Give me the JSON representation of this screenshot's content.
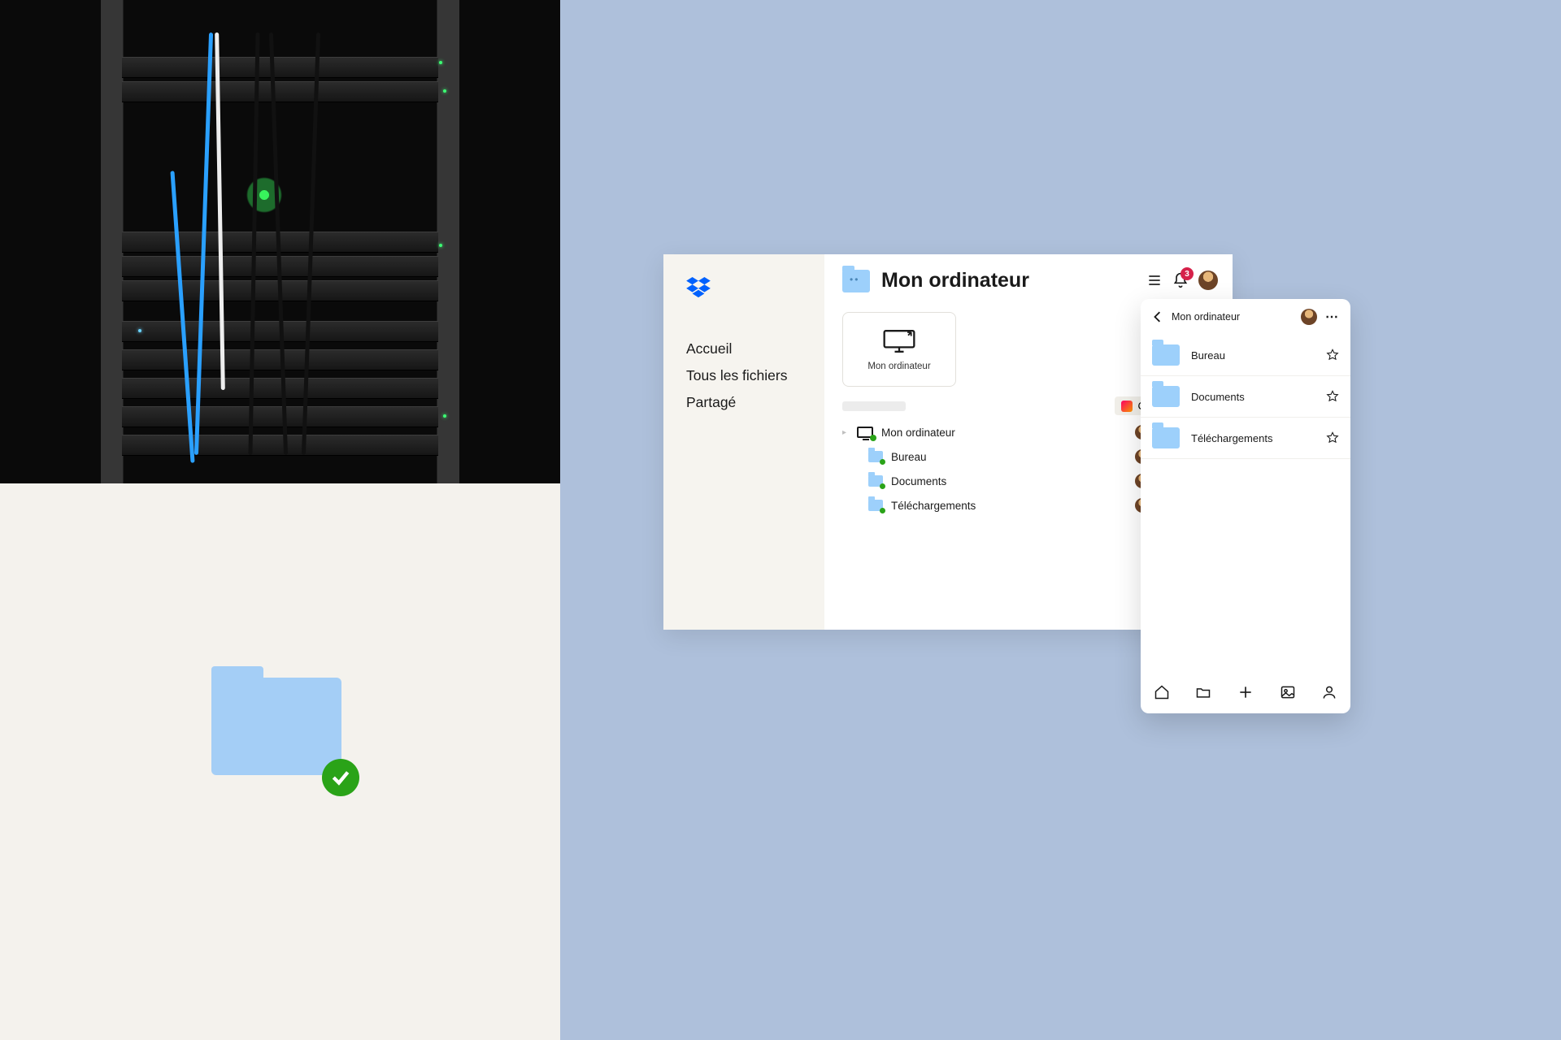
{
  "sidebar": {
    "items": [
      {
        "label": "Accueil"
      },
      {
        "label": "Tous les fichiers"
      },
      {
        "label": "Partagé"
      }
    ]
  },
  "header": {
    "title": "Mon ordinateur",
    "notification_count": "3"
  },
  "device_card": {
    "label": "Mon ordinateur"
  },
  "toolbar": {
    "create_label": "Créer"
  },
  "rows": [
    {
      "name": "Mon ordinateur"
    },
    {
      "name": "Bureau"
    },
    {
      "name": "Documents"
    },
    {
      "name": "Téléchargements"
    }
  ],
  "mobile": {
    "title": "Mon ordinateur",
    "items": [
      {
        "label": "Bureau"
      },
      {
        "label": "Documents"
      },
      {
        "label": "Téléchargements"
      }
    ]
  }
}
